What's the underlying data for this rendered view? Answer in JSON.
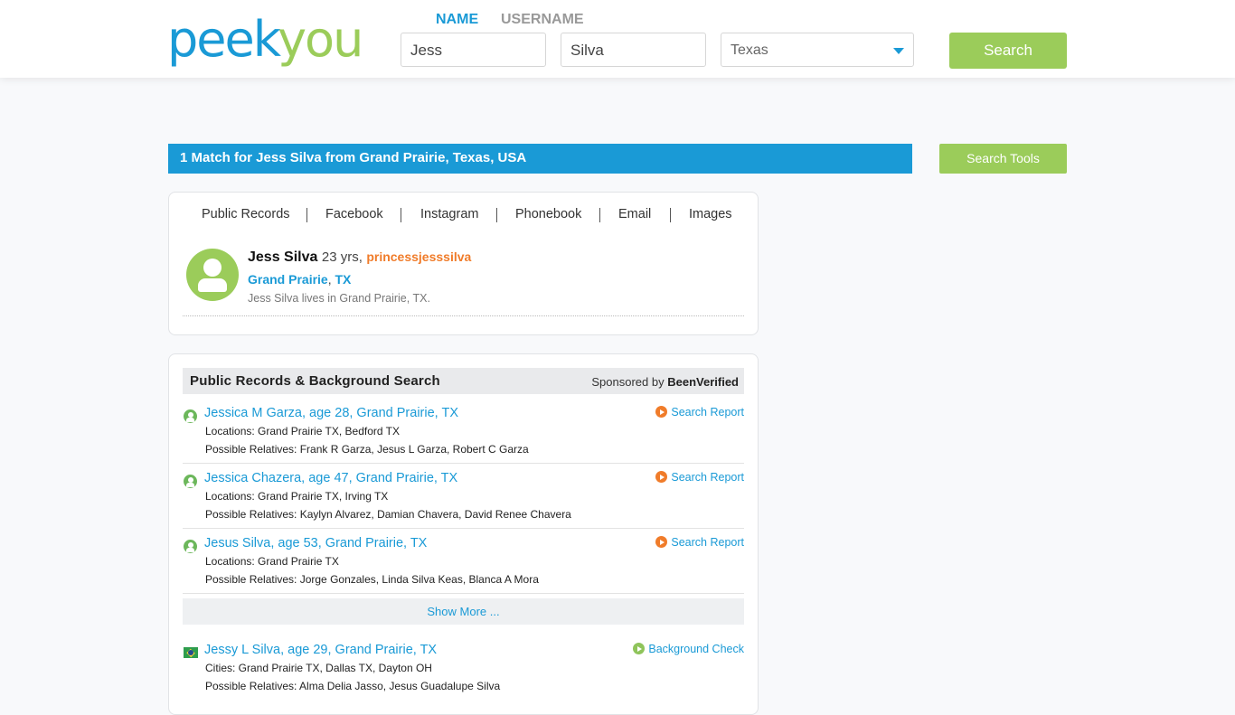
{
  "header": {
    "logo_part1": "peek",
    "logo_part2": "you",
    "tabs": [
      {
        "label": "NAME"
      },
      {
        "label": "USERNAME"
      }
    ],
    "first_name": "Jess",
    "last_name": "Silva",
    "state": "Texas",
    "search_label": "Search"
  },
  "match": {
    "heading": "1 Match for Jess Silva from Grand Prairie, Texas, USA",
    "tools_label": "Search Tools"
  },
  "profile_card": {
    "nav": [
      "Public Records",
      "Facebook",
      "Instagram",
      "Phonebook",
      "Email",
      "Images"
    ],
    "name": "Jess Silva",
    "age": "23 yrs,",
    "username": "princessjesssilva",
    "city": "Grand Prairie",
    "comma": ",",
    "state": "TX",
    "description": "Jess Silva lives in Grand Prairie, TX."
  },
  "public_records": {
    "title": "Public Records & Background Search",
    "sponsored_prefix": "Sponsored by",
    "sponsor": "BeenVerified",
    "records": [
      {
        "title": "Jessica M Garza, age 28, Grand Prairie, TX",
        "locations": "Locations: Grand Prairie TX, Bedford TX",
        "relatives": "Possible Relatives: Frank R Garza, Jesus L Garza, Robert C Garza",
        "action": "Search Report"
      },
      {
        "title": "Jessica Chazera, age 47, Grand Prairie, TX",
        "locations": "Locations: Grand Prairie TX, Irving TX",
        "relatives": "Possible Relatives: Kaylyn Alvarez, Damian Chavera, David Renee Chavera",
        "action": "Search Report"
      },
      {
        "title": "Jesus Silva, age 53, Grand Prairie, TX",
        "locations": "Locations: Grand Prairie TX",
        "relatives": "Possible Relatives: Jorge Gonzales, Linda Silva Keas, Blanca A Mora",
        "action": "Search Report"
      }
    ],
    "show_more": "Show More ...",
    "extra_record": {
      "title": "Jessy L Silva, age 29, Grand Prairie, TX",
      "cities": "Cities: Grand Prairie TX, Dallas TX, Dayton OH",
      "relatives": "Possible Relatives: Alma Delia Jasso, Jesus Guadalupe Silva",
      "action": "Background Check"
    }
  },
  "colors": {
    "brand_blue": "#1a9ad6",
    "brand_green": "#9bcc5a",
    "accent_orange": "#f07c2a"
  }
}
